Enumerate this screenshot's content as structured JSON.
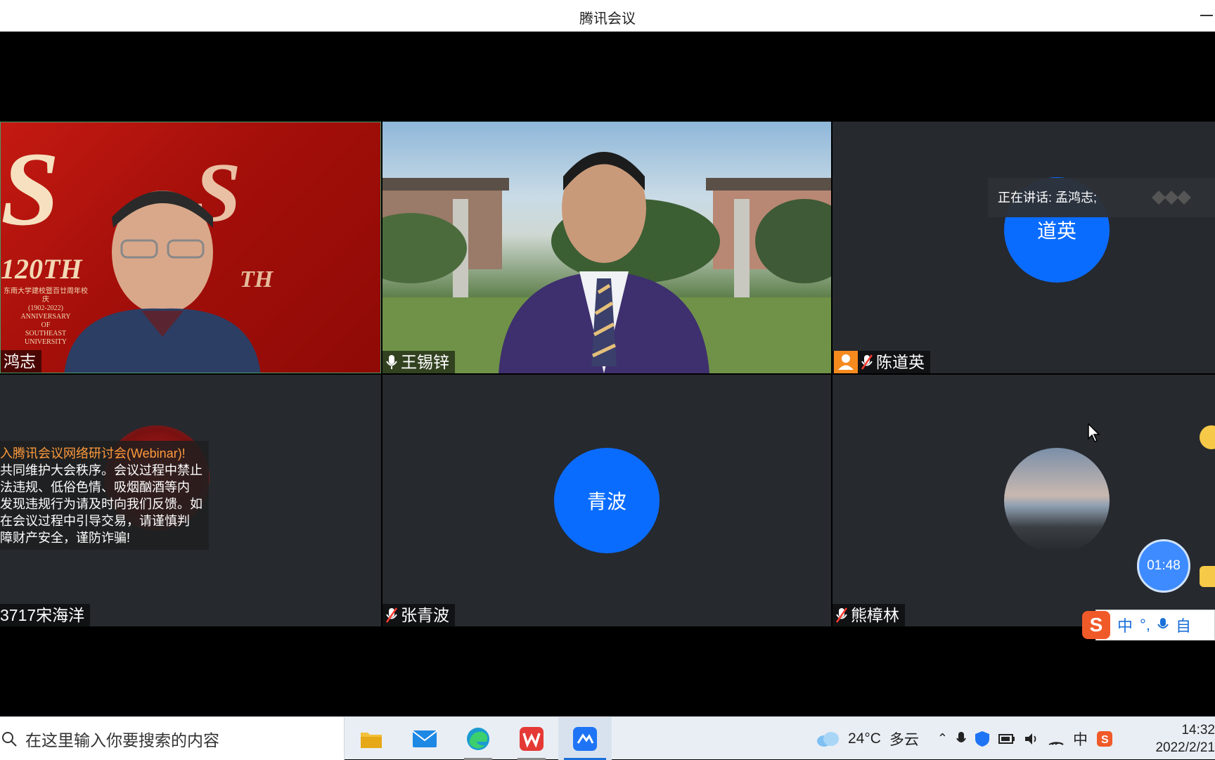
{
  "window": {
    "title": "腾讯会议"
  },
  "participants": {
    "tile1": {
      "name": "鸿志",
      "logo_text": "120TH",
      "logo_lines": [
        "东南大学建校暨百廿周年校庆",
        "(1902-2022)",
        "ANNIVERSARY",
        "OF",
        "SOUTHEAST",
        "UNIVERSITY"
      ]
    },
    "tile2": {
      "name": "王锡锌"
    },
    "tile3": {
      "name": "陈道英",
      "avatar_text": "道英"
    },
    "tile4": {
      "name": "3717宋海洋"
    },
    "tile5": {
      "name": "张青波",
      "avatar_text": "青波"
    },
    "tile6": {
      "name": "熊樟林"
    }
  },
  "speaking": {
    "label": "正在讲话: 孟鸿志;"
  },
  "notice": {
    "lines": [
      "入腾讯会议网络研讨会(Webinar)!",
      "共同维护大会秩序。会议过程中禁止",
      "法违规、低俗色情、吸烟酗酒等内",
      "发现违规行为请及时向我们反馈。如",
      "在会议过程中引导交易，请谨慎判",
      "障财产安全，谨防诈骗!"
    ]
  },
  "timer": {
    "value": "01:48"
  },
  "ime": {
    "lang": "中",
    "punct": "°,",
    "extra": "自"
  },
  "taskbar": {
    "search_placeholder": "在这里输入你要搜索的内容",
    "weather_temp": "24°C",
    "weather_desc": "多云",
    "ime_indicator": "中",
    "time": "14:32",
    "date": "2022/2/21"
  },
  "colors": {
    "avatar": "#0a6cff",
    "timer": "#3d8bff",
    "highlight": "#ff9a3c"
  }
}
